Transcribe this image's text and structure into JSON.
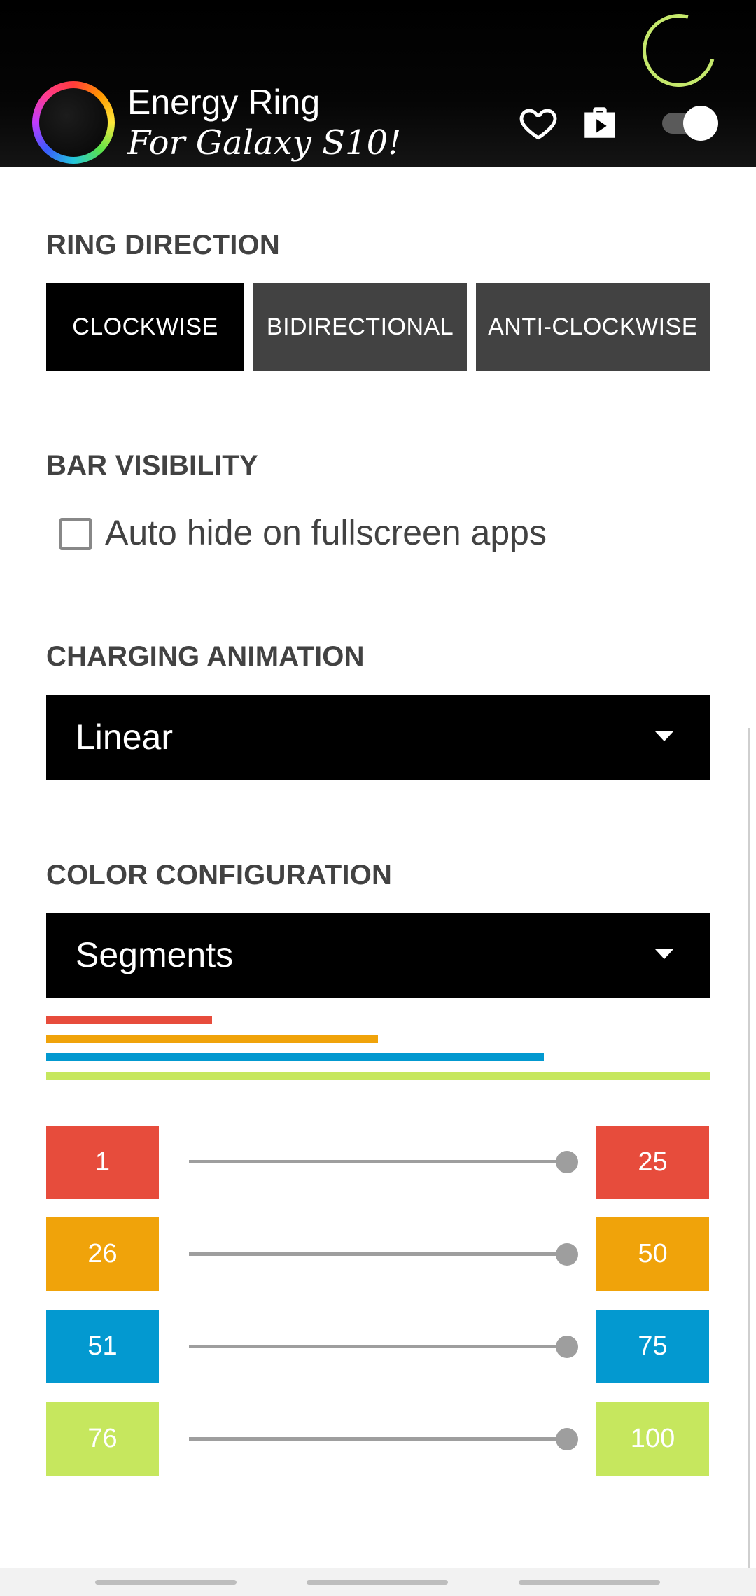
{
  "header": {
    "title": "Energy Ring",
    "subtitle": "For Galaxy S10!",
    "icons": [
      "energy-ring-logo-icon",
      "heart-icon",
      "play-store-icon",
      "toggle-switch"
    ],
    "toggle_on": true,
    "accent_color": "#c5e86c"
  },
  "ring_direction": {
    "title": "RING DIRECTION",
    "options": [
      "CLOCKWISE",
      "BIDIRECTIONAL",
      "ANTI-CLOCKWISE"
    ],
    "selected": "CLOCKWISE"
  },
  "bar_visibility": {
    "title": "BAR VISIBILITY",
    "checkbox_label": "Auto hide on fullscreen apps",
    "checked": false
  },
  "charging_animation": {
    "title": "CHARGING ANIMATION",
    "value": "Linear"
  },
  "color_configuration": {
    "title": "COLOR CONFIGURATION",
    "value": "Segments",
    "segments": [
      {
        "start": "1",
        "end": "25",
        "color": "#e74c3c",
        "slider": 1.0
      },
      {
        "start": "26",
        "end": "50",
        "color": "#f0a30a",
        "slider": 1.0
      },
      {
        "start": "51",
        "end": "75",
        "color": "#0399d0",
        "slider": 1.0
      },
      {
        "start": "76",
        "end": "100",
        "color": "#c6e75e",
        "slider": 1.0
      }
    ]
  }
}
